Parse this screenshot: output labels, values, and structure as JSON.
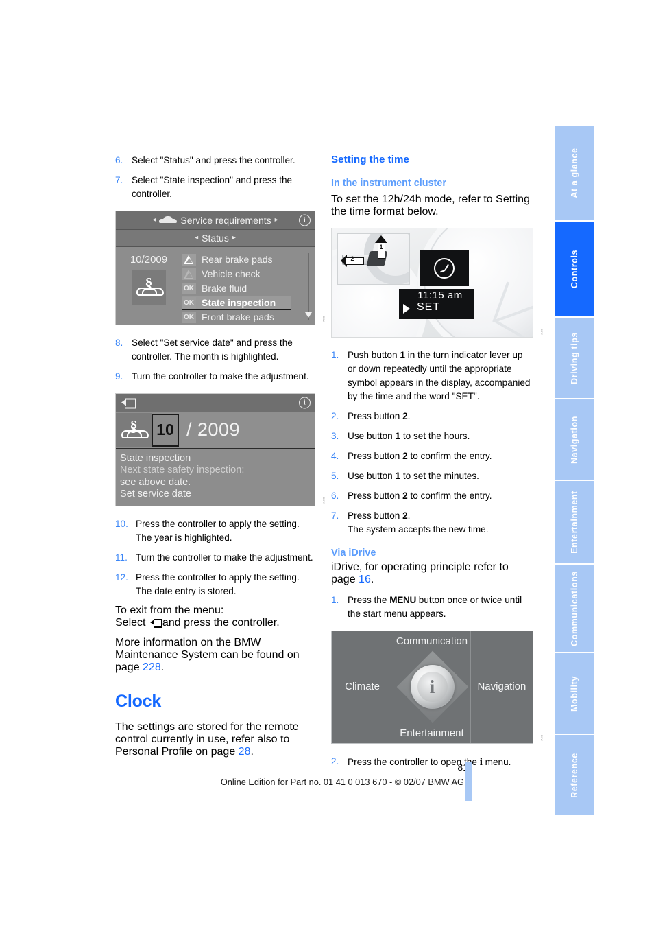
{
  "sidebar": {
    "tabs": [
      {
        "label": "At a glance",
        "active": false
      },
      {
        "label": "Controls",
        "active": true
      },
      {
        "label": "Driving tips",
        "active": false
      },
      {
        "label": "Navigation",
        "active": false
      },
      {
        "label": "Entertainment",
        "active": false
      },
      {
        "label": "Communications",
        "active": false
      },
      {
        "label": "Mobility",
        "active": false
      },
      {
        "label": "Reference",
        "active": false
      }
    ],
    "active_color": "#1569ff",
    "inactive_color": "#a8c8f5"
  },
  "left_column": {
    "steps_top": [
      {
        "num": "6.",
        "text": "Select \"Status\" and press the controller."
      },
      {
        "num": "7.",
        "text": "Select \"State inspection\" and press the controller."
      }
    ],
    "figure_service_requirements": {
      "title": "Service requirements",
      "subtitle": "Status",
      "date": "10/2009",
      "rows": [
        {
          "badge": "warn",
          "label": "Rear brake pads",
          "selected": false
        },
        {
          "badge": "warn2",
          "label": "Vehicle check",
          "selected": false
        },
        {
          "badge": "OK",
          "label": "Brake fluid",
          "selected": false
        },
        {
          "badge": "OK",
          "label": "State inspection",
          "selected": true
        },
        {
          "badge": "OK",
          "label": "Front brake pads",
          "selected": false
        }
      ]
    },
    "steps_mid": [
      {
        "num": "8.",
        "text": "Select \"Set service date\" and press the controller. The month is highlighted."
      },
      {
        "num": "9.",
        "text": "Turn the controller to make the adjustment."
      }
    ],
    "figure_set_service_date": {
      "month": "10",
      "year": "/ 2009",
      "lines": [
        "State inspection",
        "Next state safety inspection:",
        "see above date.",
        "Set service date"
      ]
    },
    "steps_bottom": [
      {
        "num": "10.",
        "text": "Press the controller to apply the setting. The year is highlighted."
      },
      {
        "num": "11.",
        "text": "Turn the controller to make the adjustment."
      },
      {
        "num": "12.",
        "text": "Press the controller to apply the setting. The date entry is stored."
      }
    ],
    "exit_note_line1": "To exit from the menu:",
    "exit_note_prefix": "Select",
    "exit_note_suffix": "and press the controller.",
    "maintenance_note_prefix": "More information on the BMW Maintenance System can be found on page ",
    "maintenance_note_page": "228",
    "maintenance_note_suffix": ".",
    "clock_heading": "Clock",
    "clock_text_prefix": "The settings are stored for the remote control currently in use, refer also to Personal Profile on page ",
    "clock_text_page": "28",
    "clock_text_suffix": "."
  },
  "right_column": {
    "heading": "Setting the time",
    "subheading_cluster": "In the instrument cluster",
    "cluster_intro": "To set the 12h/24h mode, refer to Setting the time format below.",
    "figure_cluster_photo": {
      "callout_1": "1",
      "callout_2": "2",
      "time": "11:15 am",
      "set_label": "SET"
    },
    "cluster_steps": [
      {
        "num": "1.",
        "parts": [
          {
            "t": "Push button "
          },
          {
            "t": "1",
            "b": true
          },
          {
            "t": " in the turn indicator lever up or down repeatedly until the appropriate symbol appears in the display, accompanied by the time and the word \"SET\"."
          }
        ]
      },
      {
        "num": "2.",
        "parts": [
          {
            "t": "Press button "
          },
          {
            "t": "2",
            "b": true
          },
          {
            "t": "."
          }
        ]
      },
      {
        "num": "3.",
        "parts": [
          {
            "t": "Use button "
          },
          {
            "t": "1",
            "b": true
          },
          {
            "t": " to set the hours."
          }
        ]
      },
      {
        "num": "4.",
        "parts": [
          {
            "t": "Press button "
          },
          {
            "t": "2",
            "b": true
          },
          {
            "t": " to confirm the entry."
          }
        ]
      },
      {
        "num": "5.",
        "parts": [
          {
            "t": "Use button "
          },
          {
            "t": "1",
            "b": true
          },
          {
            "t": " to set the minutes."
          }
        ]
      },
      {
        "num": "6.",
        "parts": [
          {
            "t": "Press button "
          },
          {
            "t": "2",
            "b": true
          },
          {
            "t": " to confirm the entry."
          }
        ]
      },
      {
        "num": "7.",
        "parts": [
          {
            "t": "Press button "
          },
          {
            "t": "2",
            "b": true
          },
          {
            "t": ".\nThe system accepts the new time."
          }
        ]
      }
    ],
    "subheading_idrive": "Via iDrive",
    "idrive_intro_prefix": "iDrive, for operating principle refer to page ",
    "idrive_intro_page": "16",
    "idrive_intro_suffix": ".",
    "idrive_step1_prefix": "Press the ",
    "idrive_step1_button": "MENU",
    "idrive_step1_suffix": " button once or twice until the start menu appears.",
    "idrive_step1_num": "1.",
    "figure_idrive_menu": {
      "cells": [
        "",
        "Communication",
        "",
        "Climate",
        "",
        "Navigation",
        "",
        "Entertainment",
        ""
      ],
      "center_icon": "i"
    },
    "idrive_step2_num": "2.",
    "idrive_step2_prefix": "Press the controller to open the ",
    "idrive_step2_icon": "i",
    "idrive_step2_suffix": " menu."
  },
  "footer": {
    "page_number": "81",
    "text": "Online Edition for Part no. 01 41 0 013 670 - © 02/07 BMW AG"
  }
}
